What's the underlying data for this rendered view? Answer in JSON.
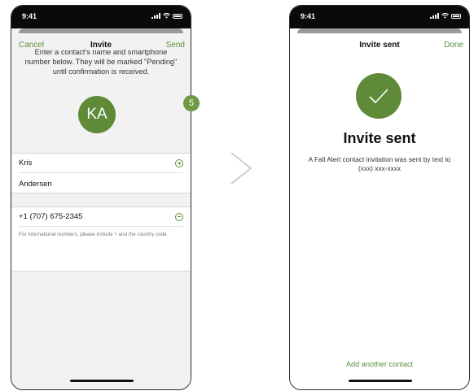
{
  "status_time": "9:41",
  "colors": {
    "accent": "#5a8f3c",
    "avatar": "#5f8a37",
    "badge": "#6f9a45"
  },
  "left_screen": {
    "nav": {
      "cancel": "Cancel",
      "title": "Invite",
      "send": "Send"
    },
    "instruction": "Enter a contact's name and smartphone number below. They will be marked \"Pending\" until confirmation is received.",
    "avatar_initials": "KA",
    "first_name": "Kris",
    "last_name": "Andersen",
    "phone_number": "+1 (707) 675-2345",
    "helper_text": "For international numbers, please include + and the country code.",
    "step_badge": "5"
  },
  "right_screen": {
    "nav": {
      "title": "Invite sent",
      "done": "Done"
    },
    "heading": "Invite sent",
    "message": "A Fall Alert contact invitation was sent by text to (xxx) xxx-xxxx",
    "add_another": "Add another contact"
  },
  "icons": [
    "signal-icon",
    "wifi-icon",
    "battery-icon",
    "add-circle-icon",
    "remove-circle-icon",
    "checkmark-icon",
    "chevron-right-icon"
  ]
}
